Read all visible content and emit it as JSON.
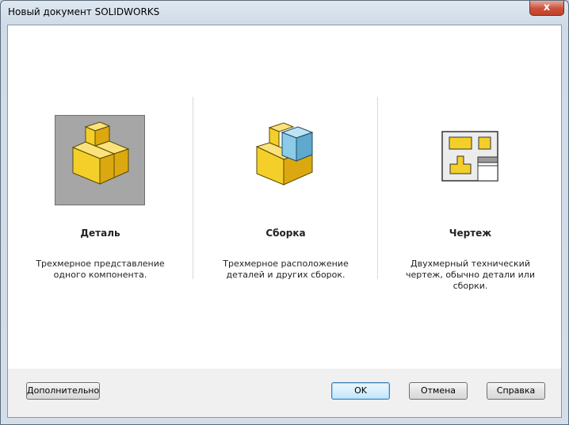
{
  "window": {
    "title": "Новый документ SOLIDWORKS",
    "close_glyph": "x"
  },
  "options": [
    {
      "label": "Деталь",
      "description": "Трехмерное представление одного компонента.",
      "icon": "part-icon",
      "selected": true
    },
    {
      "label": "Сборка",
      "description": "Трехмерное расположение деталей и других сборок.",
      "icon": "assembly-icon",
      "selected": false
    },
    {
      "label": "Чертеж",
      "description": "Двухмерный технический чертеж, обычно детали или сборки.",
      "icon": "drawing-icon",
      "selected": false
    }
  ],
  "buttons": {
    "advanced": "Дополнительно",
    "ok": "OK",
    "cancel": "Отмена",
    "help": "Справка"
  },
  "colors": {
    "part_yellow": "#f2cc28",
    "assembly_blue": "#7fc3e3",
    "selected_bg": "#a6a6a6"
  }
}
